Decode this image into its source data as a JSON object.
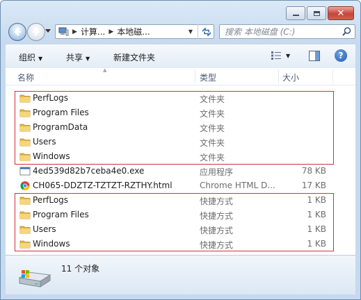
{
  "window": {
    "caption": {
      "minimize": "minimize",
      "maximize": "maximize",
      "close": "close"
    }
  },
  "address": {
    "segments": [
      "计算...",
      "本地磁..."
    ],
    "search_placeholder": "搜索 本地磁盘 (C:)"
  },
  "toolbar": {
    "organize": "组织",
    "share": "共享",
    "new_folder": "新建文件夹"
  },
  "columns": {
    "name": "名称",
    "type": "类型",
    "size": "大小"
  },
  "files": [
    {
      "name": "PerfLogs",
      "type": "文件夹",
      "size": "",
      "icon": "folder-icon"
    },
    {
      "name": "Program Files",
      "type": "文件夹",
      "size": "",
      "icon": "folder-icon"
    },
    {
      "name": "ProgramData",
      "type": "文件夹",
      "size": "",
      "icon": "folder-icon"
    },
    {
      "name": "Users",
      "type": "文件夹",
      "size": "",
      "icon": "folder-icon"
    },
    {
      "name": "Windows",
      "type": "文件夹",
      "size": "",
      "icon": "folder-icon"
    },
    {
      "name": "4ed539d82b7ceba4e0.exe",
      "type": "应用程序",
      "size": "78 KB",
      "icon": "exe-icon"
    },
    {
      "name": "CH065-DDZTZ-TZTZT-RZTHY.html",
      "type": "Chrome HTML D...",
      "size": "17 KB",
      "icon": "chrome-icon"
    },
    {
      "name": "PerfLogs",
      "type": "快捷方式",
      "size": "1 KB",
      "icon": "folder-icon"
    },
    {
      "name": "Program Files",
      "type": "快捷方式",
      "size": "1 KB",
      "icon": "folder-icon"
    },
    {
      "name": "Users",
      "type": "快捷方式",
      "size": "1 KB",
      "icon": "folder-icon"
    },
    {
      "name": "Windows",
      "type": "快捷方式",
      "size": "1 KB",
      "icon": "folder-icon"
    }
  ],
  "status": {
    "item_count": "11 个对象"
  },
  "colors": {
    "highlight_box": "#d0313d",
    "type_text": "#6d6d6d",
    "header_text": "#4a5a76"
  }
}
